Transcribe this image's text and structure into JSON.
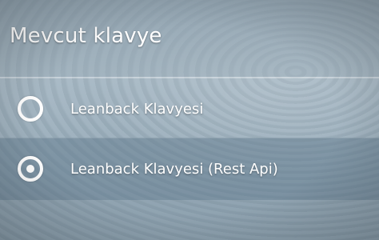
{
  "header": {
    "title": "Mevcut klavye"
  },
  "options": [
    {
      "label": "Leanback Klavyesi",
      "selected": false
    },
    {
      "label": "Leanback Klavyesi (Rest Api)",
      "selected": true
    }
  ],
  "colors": {
    "text": "#ffffff",
    "highlight_row": "#607a8c"
  }
}
